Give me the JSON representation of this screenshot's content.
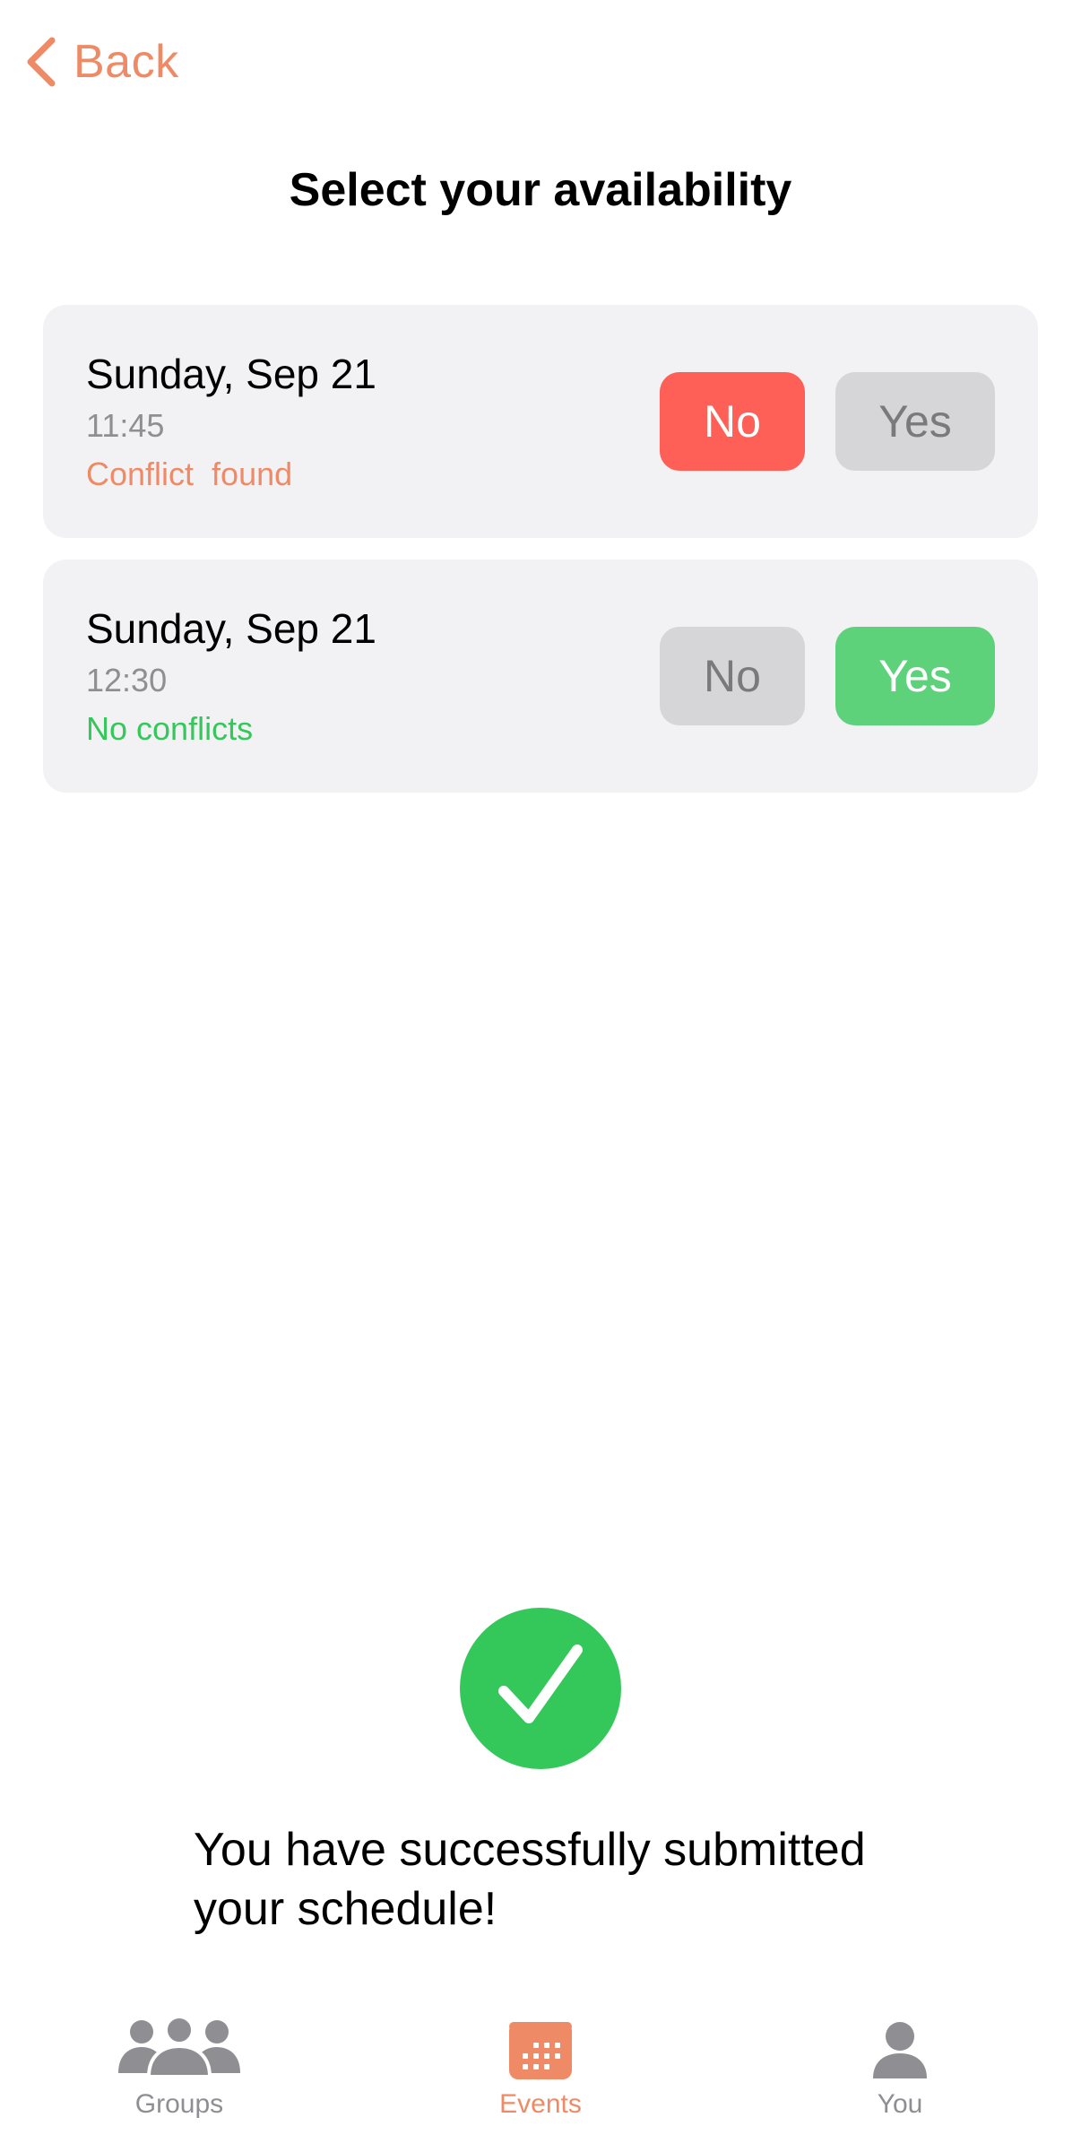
{
  "header": {
    "back_label": "Back",
    "title": "Select your availability"
  },
  "slots": [
    {
      "date": "Sunday, Sep 21",
      "time": "11:45",
      "status": "Conflict  found",
      "no_label": "No",
      "yes_label": "Yes",
      "selected": "No"
    },
    {
      "date": "Sunday, Sep 21",
      "time": "12:30",
      "status": "No conflicts",
      "no_label": "No",
      "yes_label": "Yes",
      "selected": "Yes"
    }
  ],
  "success": {
    "icon": "checkmark-circle-icon",
    "message": "You have successfully submitted your schedule!"
  },
  "tabbar": {
    "items": [
      {
        "label": "Groups",
        "icon": "groups-icon",
        "active": false
      },
      {
        "label": "Events",
        "icon": "calendar-icon",
        "active": true
      },
      {
        "label": "You",
        "icon": "person-icon",
        "active": false
      }
    ]
  },
  "colors": {
    "accent": "#ef8a66",
    "no_selected": "#fe5f57",
    "yes_selected": "#5ed27b",
    "success": "#34c759",
    "unselected_button": "#d6d6d8",
    "card_background": "#f2f2f5"
  }
}
